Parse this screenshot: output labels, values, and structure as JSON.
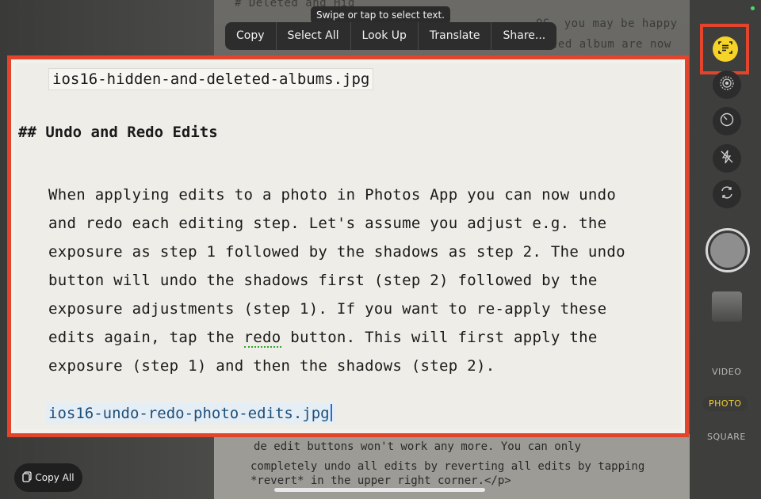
{
  "hint": "Swipe or tap to select text.",
  "menu": {
    "items": [
      "Copy",
      "Select All",
      "Look Up",
      "Translate",
      "Share..."
    ]
  },
  "background_text": {
    "top_left": "# Deleted and Hid",
    "line1": "OS, you may be happy",
    "line2": "to hear that the hidden album and the deleted album are now",
    "bottom1": "de edit buttons won't work any more. You can only",
    "bottom2": "completely undo all edits by reverting all edits by tapping",
    "bottom3": "*revert* in the upper right corner.</p>"
  },
  "document": {
    "filename_top": "ios16-hidden-and-deleted-albums.jpg",
    "heading": "## Undo and Redo Edits",
    "paragraph": [
      "When applying edits to a photo in Photos App you can now undo",
      "and redo each editing step. Let's assume you adjust e.g. the",
      "exposure as step 1 followed by the shadows as step 2. The undo",
      "button will undo the shadows first (step 2) followed by the",
      "exposure adjustments (step 1). If you want to re-apply these"
    ],
    "line6_before": "edits again, tap the ",
    "line6_link": "redo",
    "line6_after": " button. This will first apply the",
    "line7": "exposure (step 1) and then the shadows (step 2).",
    "filename_bottom": "ios16-undo-redo-photo-edits.jpg"
  },
  "copy_all": "Copy All",
  "camera": {
    "modes": [
      "VIDEO",
      "PHOTO",
      "SQUARE"
    ],
    "active_mode": "PHOTO"
  },
  "colors": {
    "highlight": "#e2452b",
    "live_text": "#f5d328",
    "active_mode": "#f3d22b"
  }
}
